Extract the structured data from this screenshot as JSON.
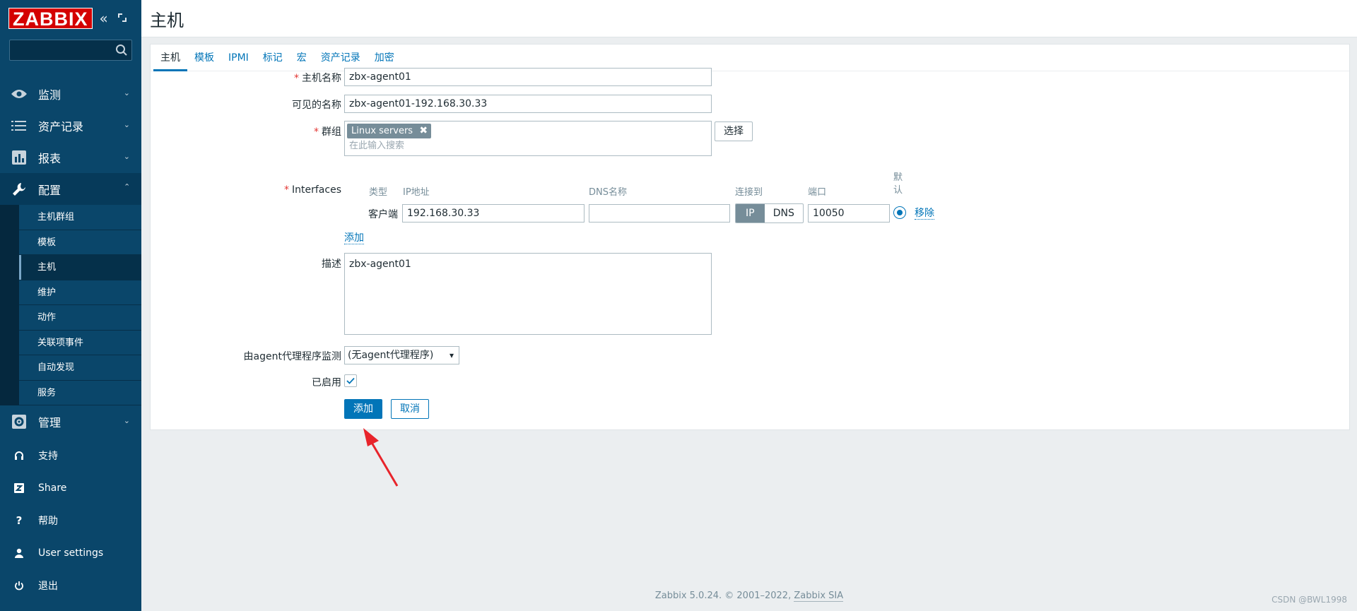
{
  "sidebar": {
    "logo": "ZABBIX",
    "search": {
      "placeholder": "",
      "value": ""
    },
    "menu": [
      {
        "label": "监测",
        "icon": "eye-icon"
      },
      {
        "label": "资产记录",
        "icon": "list-icon"
      },
      {
        "label": "报表",
        "icon": "bar-chart-icon"
      },
      {
        "label": "配置",
        "icon": "wrench-icon"
      },
      {
        "label": "管理",
        "icon": "gear-icon"
      }
    ],
    "config_submenu": [
      "主机群组",
      "模板",
      "主机",
      "维护",
      "动作",
      "关联项事件",
      "自动发现",
      "服务"
    ],
    "bottom": [
      {
        "label": "支持",
        "icon": "headset-icon"
      },
      {
        "label": "Share",
        "icon": "share-z-icon"
      },
      {
        "label": "帮助",
        "icon": "help-icon"
      },
      {
        "label": "User settings",
        "icon": "user-icon"
      },
      {
        "label": "退出",
        "icon": "power-icon"
      }
    ]
  },
  "page": {
    "title": "主机"
  },
  "tabs": [
    "主机",
    "模板",
    "IPMI",
    "标记",
    "宏",
    "资产记录",
    "加密"
  ],
  "form": {
    "host_name": {
      "label": "主机名称",
      "value": "zbx-agent01"
    },
    "visible_name": {
      "label": "可见的名称",
      "value": "zbx-agent01-192.168.30.33"
    },
    "groups": {
      "label": "群组",
      "chip": "Linux servers",
      "placeholder": "在此输入搜索",
      "select_button": "选择"
    },
    "interfaces": {
      "label": "Interfaces",
      "headers": {
        "type": "类型",
        "ip": "IP地址",
        "dns": "DNS名称",
        "connect": "连接到",
        "port": "端口",
        "default": "默认"
      },
      "row": {
        "type": "客户端",
        "ip": "192.168.30.33",
        "dns": "",
        "connect_ip": "IP",
        "connect_dns": "DNS",
        "port": "10050",
        "remove": "移除"
      },
      "add": "添加"
    },
    "description": {
      "label": "描述",
      "value": "zbx-agent01"
    },
    "proxy": {
      "label": "由agent代理程序监测",
      "value": "(无agent代理程序)"
    },
    "enabled": {
      "label": "已启用",
      "checked": true
    },
    "add_button": "添加",
    "cancel_button": "取消"
  },
  "footer": {
    "text": "Zabbix 5.0.24. © 2001–2022,",
    "link": "Zabbix SIA"
  },
  "watermark": "CSDN @BWL1998",
  "colors": {
    "sidebar": "#0a466a",
    "accent": "#0275b8",
    "logo": "#d40000",
    "annotation_arrow": "#e8242b"
  }
}
